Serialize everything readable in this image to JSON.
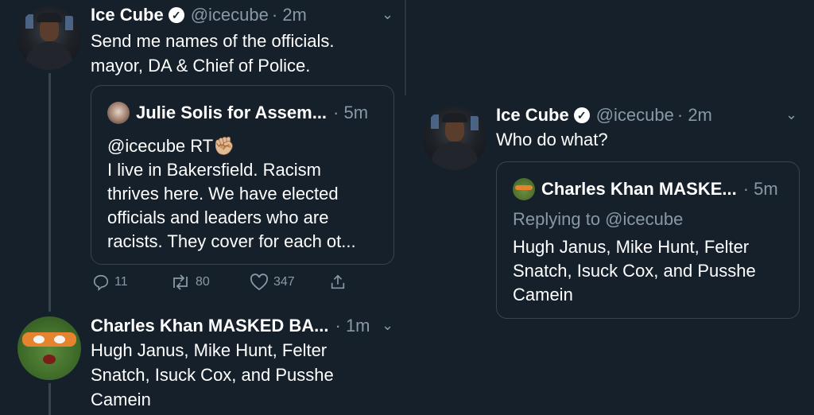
{
  "left": {
    "tweet1": {
      "name": "Ice Cube",
      "handle": "@icecube",
      "time": "· 2m",
      "text": "Send me names of the officials.\nmayor, DA & Chief of Police."
    },
    "quote": {
      "name": "Julie Solis for Assem...",
      "time": "· 5m",
      "text": "@icecube RT✊🏼\nI live in Bakersfield. Racism\nthrives here. We have elected\nofficials and leaders who are\nracists. They cover for each ot..."
    },
    "actions": {
      "replies": "11",
      "retweets": "80",
      "likes": "347"
    },
    "tweet2": {
      "name": "Charles Khan MASKED BA...",
      "time": "· 1m",
      "text": "Hugh Janus, Mike Hunt, Felter\nSnatch, Isuck Cox, and Pusshe\nCamein"
    }
  },
  "right": {
    "tweet": {
      "name": "Ice Cube",
      "handle": "@icecube",
      "time": "· 2m",
      "text": "Who do what?"
    },
    "quote": {
      "name": "Charles Khan MASKE...",
      "time": "· 5m",
      "replying": "Replying to @icecube",
      "text": "Hugh Janus, Mike Hunt, Felter\nSnatch, Isuck Cox, and Pusshe\nCamein"
    }
  },
  "colors": {
    "background": "#15202b",
    "secondary_text": "#8899a6",
    "border": "#38444d"
  },
  "icons": [
    "verified-icon",
    "chevron-down-icon",
    "reply-icon",
    "retweet-icon",
    "like-icon",
    "share-icon"
  ]
}
